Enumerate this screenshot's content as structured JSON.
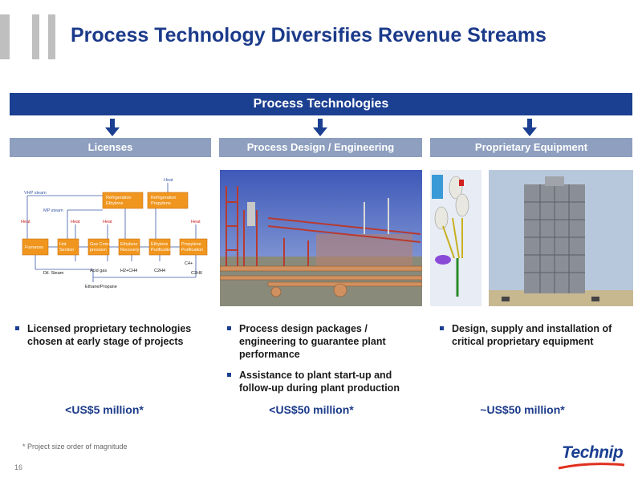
{
  "title": "Process Technology Diversifies Revenue Streams",
  "banner": "Process Technologies",
  "columns": [
    {
      "header": "Licenses",
      "bullets": [
        "Licensed proprietary technologies chosen at early stage of projects"
      ],
      "revenue": "<US$5 million*"
    },
    {
      "header": "Process Design / Engineering",
      "bullets": [
        "Process design packages / engineering to guarantee plant performance",
        "Assistance to plant start-up and follow-up during plant production"
      ],
      "revenue": "<US$50 million*"
    },
    {
      "header": "Proprietary Equipment",
      "bullets": [
        "Design, supply and installation of critical proprietary equipment"
      ],
      "revenue": "~US$50 million*"
    }
  ],
  "flow_diagram": {
    "heat_top": "Heat",
    "vhp_steam": "VHP steam",
    "mp_steam": "MP steam",
    "heat": "Heat",
    "ref_ethylene": [
      "Refrigeration",
      "Ethylene"
    ],
    "ref_propylene": [
      "Refrigeration",
      "Propylene"
    ],
    "furnaces": "Furnaces",
    "hot_section": [
      "Hot",
      "Section"
    ],
    "gas_compression": [
      "Gas Com-",
      "pression"
    ],
    "ethylene_recovery": [
      "Ethylene",
      "Recovery"
    ],
    "ethylene_purification": [
      "Ethylene",
      "Purification"
    ],
    "propylene_purification": [
      "Propylene",
      "Purification"
    ],
    "c4": "C4+",
    "dil_steam": "Dil. Steam",
    "acid_gas": "Acid gas",
    "h2_ch4": "H2+CH4",
    "c2h4": "C2H4",
    "c3h6": "C3H6",
    "feed": "Ethane/Propane"
  },
  "footnote": "* Project size order of magnitude",
  "page_number": "16",
  "logo": "Technip",
  "colors": {
    "brand_blue": "#1b3f91",
    "header_grey_blue": "#8e9fbf",
    "flow_orange": "#f0961e"
  }
}
